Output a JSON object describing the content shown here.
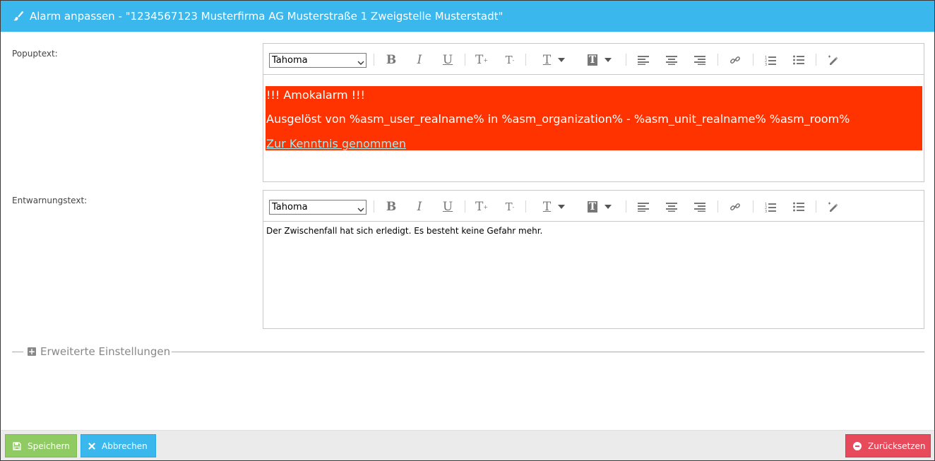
{
  "title": {
    "icon": "paintbrush-icon",
    "text": "Alarm anpassen - \"1234567123 Musterfirma AG Musterstraße 1 Zweigstelle Musterstadt\""
  },
  "popup": {
    "label": "Popuptext:",
    "font": "Tahoma",
    "lines": [
      "!!! Amokalarm !!!",
      "Ausgelöst von %asm_user_realname% in %asm_organization% - %asm_unit_realname% %asm_room%",
      "Zur Kenntnis genommen"
    ],
    "background_color": "#ff3300",
    "text_color": "#ffffff",
    "link_color": "#a4ecee"
  },
  "entwarnung": {
    "label": "Entwarnungstext:",
    "font": "Tahoma",
    "text": "Der Zwischenfall hat sich erledigt. Es besteht keine Gefahr mehr."
  },
  "toolbar_icons": [
    "bold-icon",
    "italic-icon",
    "underline-icon",
    "superscript-icon",
    "subscript-icon",
    "text-color-icon",
    "background-color-icon",
    "align-left-icon",
    "align-center-icon",
    "align-right-icon",
    "link-icon",
    "ordered-list-icon",
    "unordered-list-icon",
    "clear-format-icon"
  ],
  "advanced": {
    "label": "Erweiterte Einstellungen",
    "icon": "plus-square-icon"
  },
  "footer": {
    "save_label": "Speichern",
    "cancel_label": "Abbrechen",
    "reset_label": "Zurücksetzen"
  },
  "colors": {
    "titlebar": "#3ab8ee",
    "save": "#8fcb62",
    "cancel": "#3ab8ee",
    "reset": "#e64a5b"
  }
}
